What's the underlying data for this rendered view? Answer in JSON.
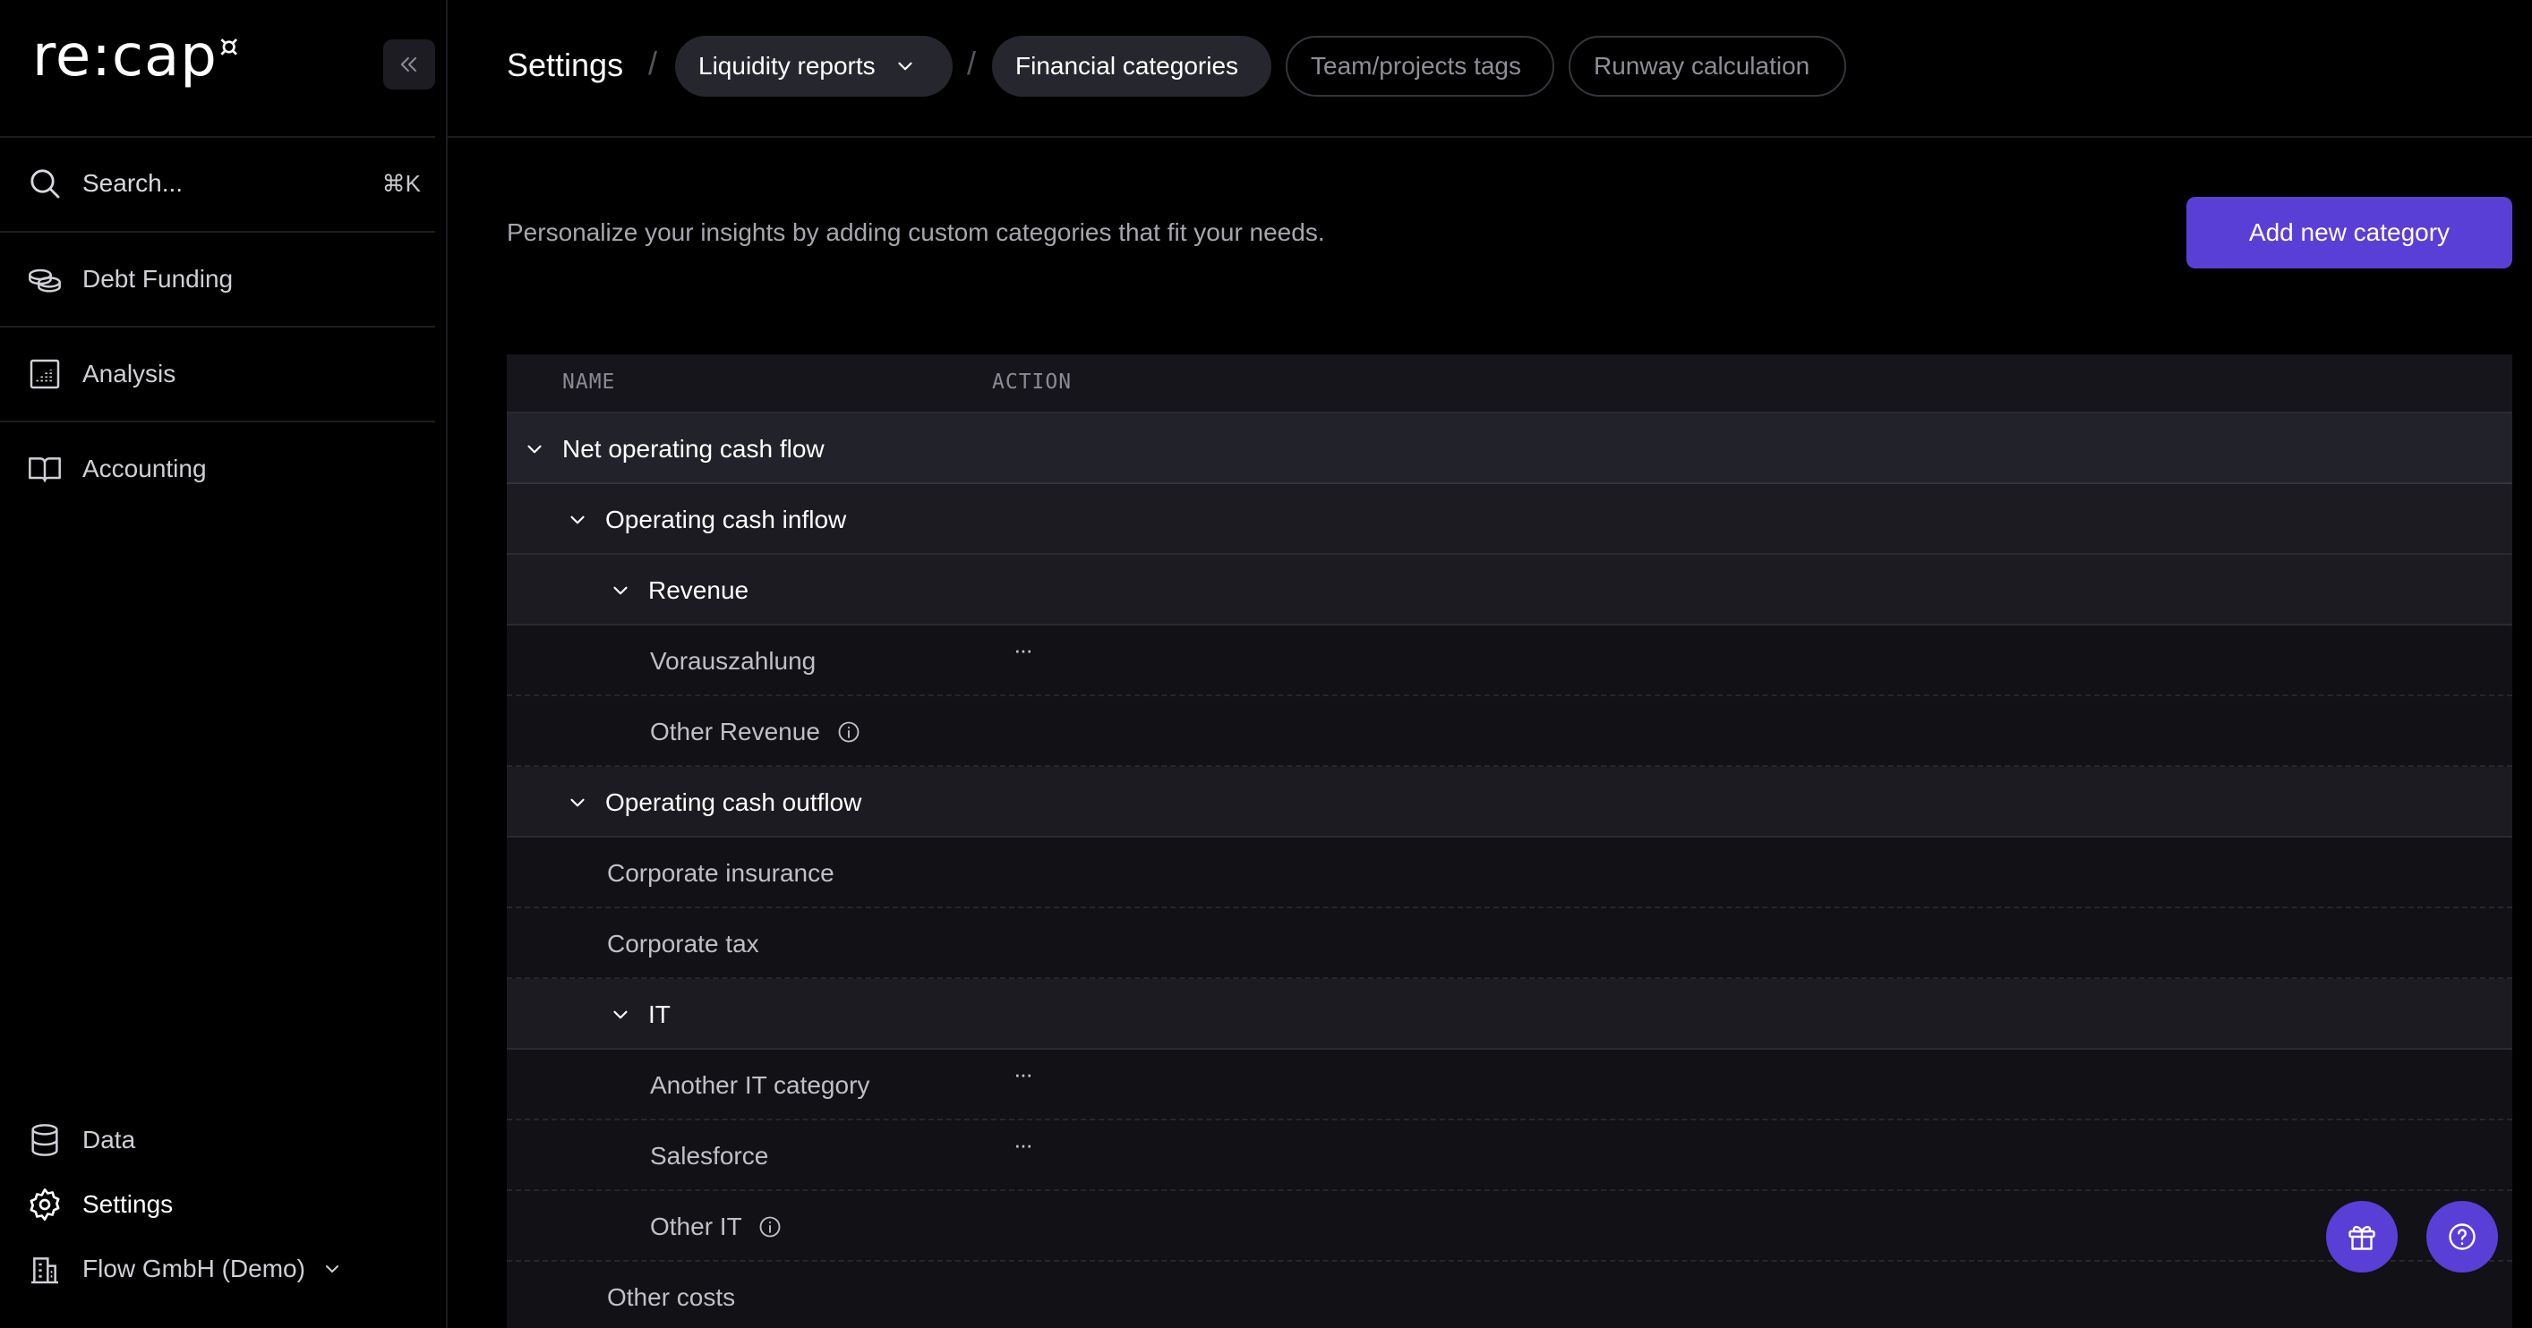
{
  "app": {
    "logo_text": "re:cap",
    "logo_mark": "¤"
  },
  "sidebar": {
    "search": {
      "label": "Search...",
      "shortcut": "⌘K"
    },
    "items": [
      {
        "label": "Debt Funding",
        "icon": "coins-icon"
      },
      {
        "label": "Analysis",
        "icon": "chart-grid-icon"
      },
      {
        "label": "Accounting",
        "icon": "book-icon"
      }
    ],
    "bottom": [
      {
        "label": "Data",
        "icon": "database-icon"
      },
      {
        "label": "Settings",
        "icon": "gear-icon",
        "active": true
      },
      {
        "label": "Flow GmbH (Demo)",
        "icon": "building-icon"
      }
    ]
  },
  "header": {
    "title": "Settings",
    "tabs": [
      {
        "label": "Liquidity reports",
        "style": "filled",
        "dropdown": true
      },
      {
        "label": "Financial categories",
        "style": "filled",
        "selected": true
      },
      {
        "label": "Team/projects tags",
        "style": "outline"
      },
      {
        "label": "Runway calculation",
        "style": "outline"
      }
    ]
  },
  "main": {
    "intro": "Personalize your insights by adding custom categories that fit your needs.",
    "add_button": "Add new category",
    "table": {
      "columns": {
        "name": "NAME",
        "action": "ACTION"
      },
      "rows": [
        {
          "label": "Net operating cash flow",
          "level": 0,
          "kind": "top",
          "expandable": true
        },
        {
          "label": "Operating cash inflow",
          "level": 1,
          "kind": "group",
          "expandable": true
        },
        {
          "label": "Revenue",
          "level": 2,
          "kind": "group",
          "expandable": true
        },
        {
          "label": "Vorauszahlung",
          "level": 3,
          "kind": "leaf",
          "action": "···"
        },
        {
          "label": "Other Revenue",
          "level": 3,
          "kind": "leaf",
          "info": true
        },
        {
          "label": "Operating cash outflow",
          "level": 1,
          "kind": "group",
          "expandable": true
        },
        {
          "label": "Corporate insurance",
          "level": 2,
          "kind": "leaf"
        },
        {
          "label": "Corporate tax",
          "level": 2,
          "kind": "leaf"
        },
        {
          "label": "IT",
          "level": 2,
          "kind": "group",
          "expandable": true
        },
        {
          "label": "Another IT category",
          "level": 3,
          "kind": "leaf",
          "action": "···"
        },
        {
          "label": "Salesforce",
          "level": 3,
          "kind": "leaf",
          "action": "···"
        },
        {
          "label": "Other IT",
          "level": 3,
          "kind": "leaf",
          "info": true
        },
        {
          "label": "Other costs",
          "level": 2,
          "kind": "leaf"
        }
      ]
    }
  },
  "floating": [
    {
      "icon": "gift-icon"
    },
    {
      "icon": "help-icon"
    }
  ],
  "colors": {
    "accent": "#5a3fd6",
    "background": "#000000",
    "table_bg": "#111116"
  }
}
